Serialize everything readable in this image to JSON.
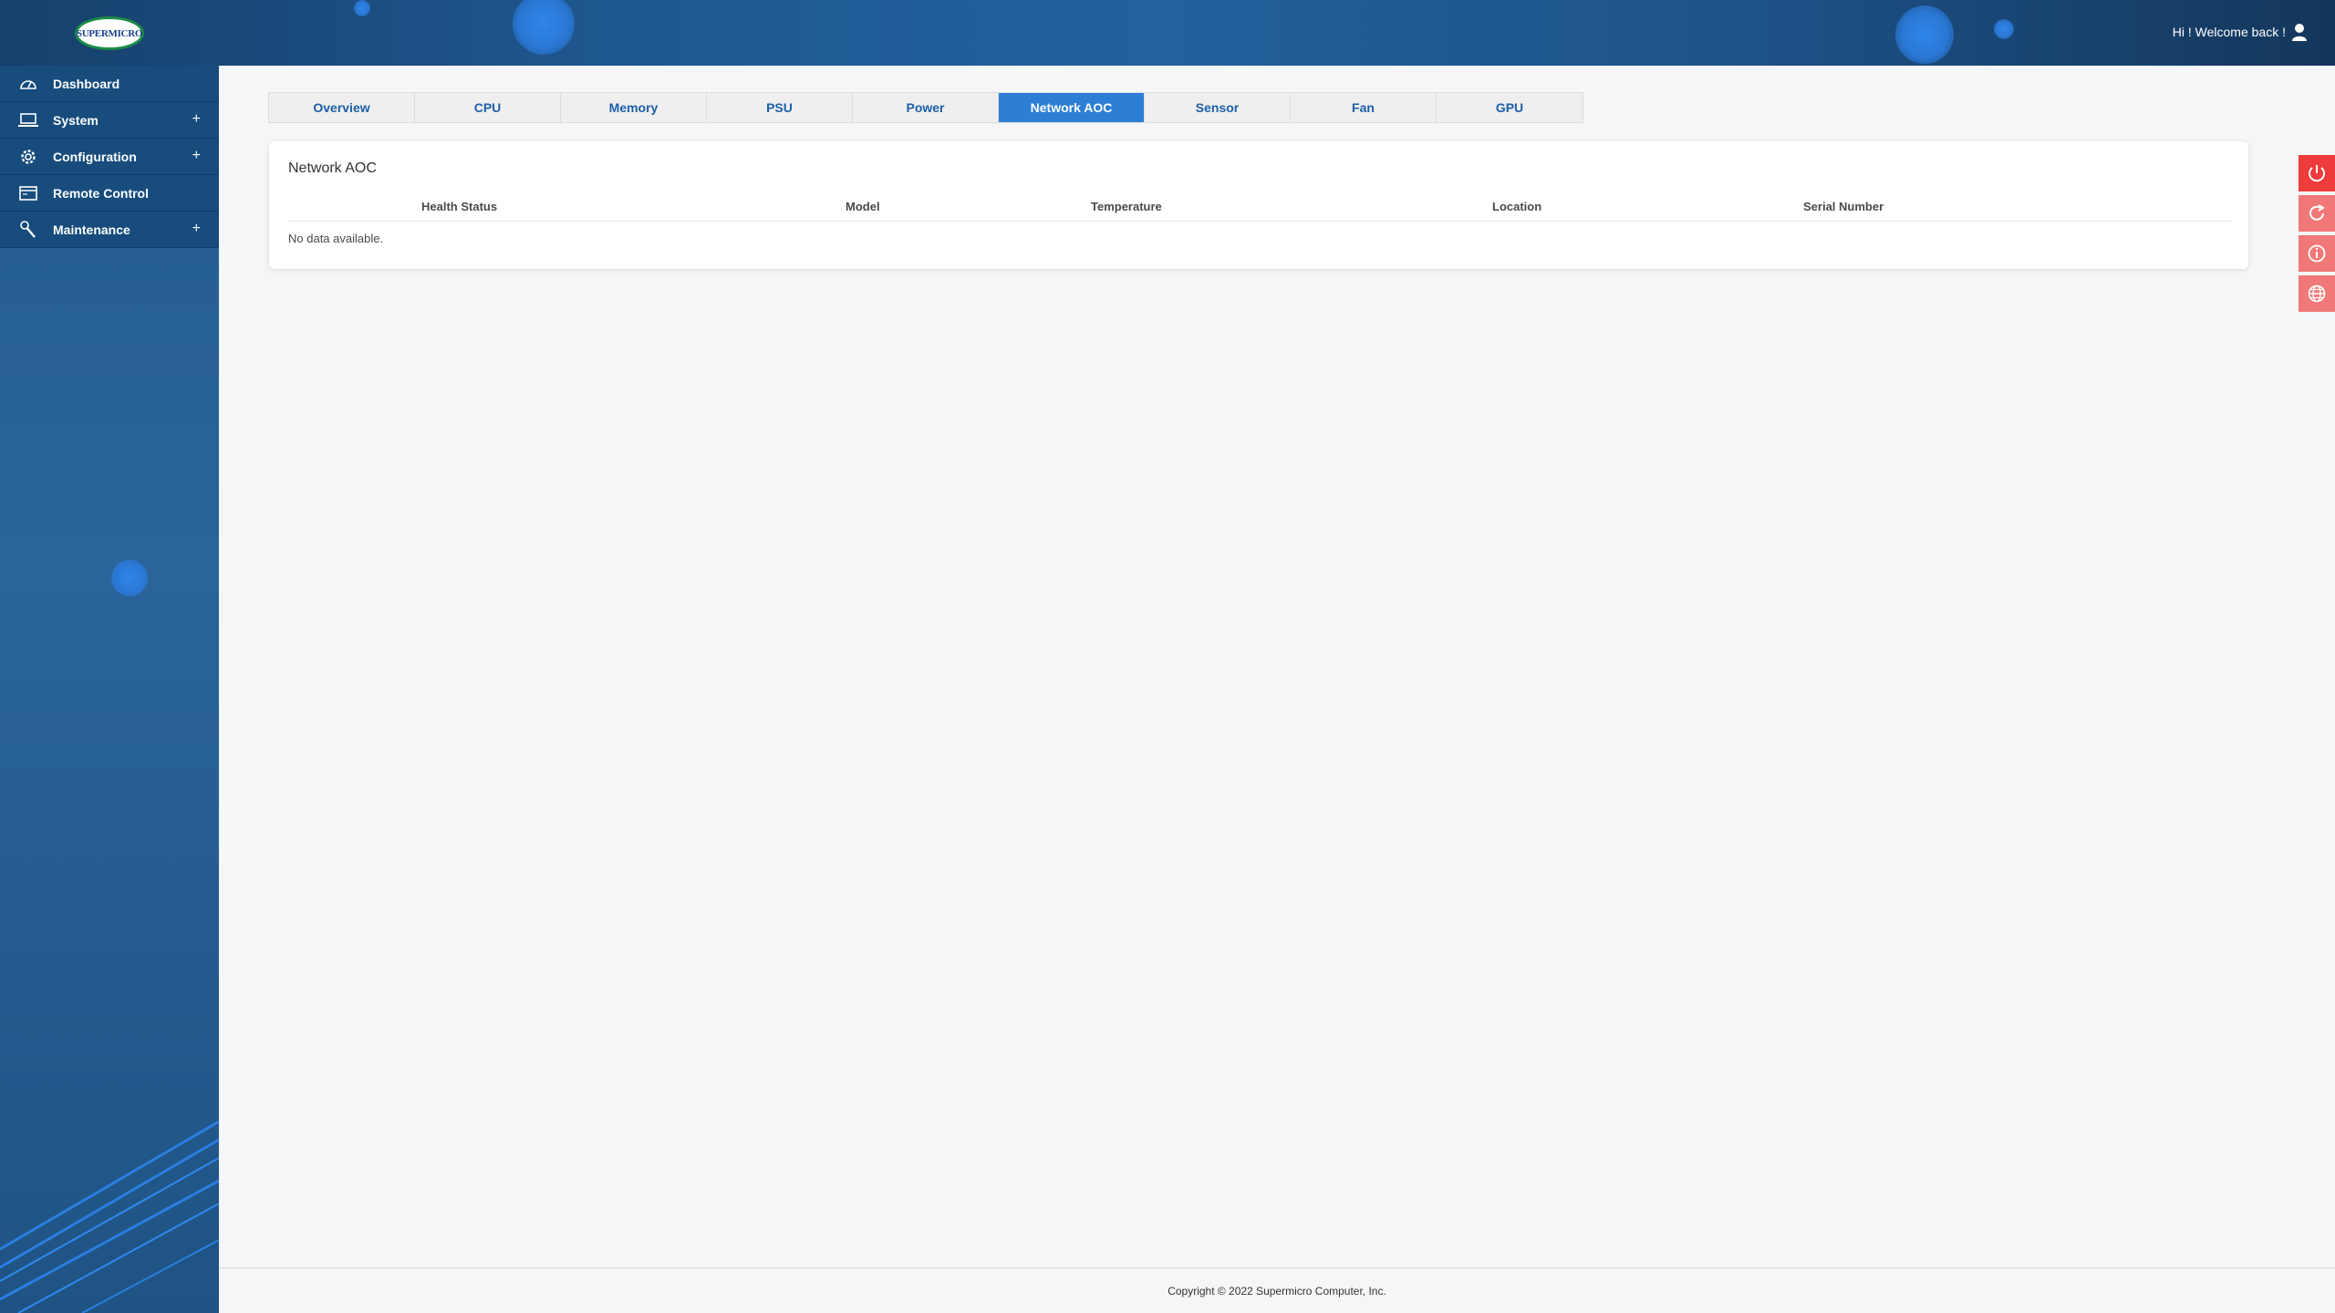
{
  "header": {
    "logo_text": "SUPERMICRO",
    "welcome": "Hi ! Welcome back !"
  },
  "sidebar": {
    "items": [
      {
        "label": "Dashboard",
        "icon": "dashboard-gauge-icon",
        "expandable": false
      },
      {
        "label": "System",
        "icon": "laptop-icon",
        "expandable": true
      },
      {
        "label": "Configuration",
        "icon": "gear-icon",
        "expandable": true
      },
      {
        "label": "Remote Control",
        "icon": "console-window-icon",
        "expandable": false
      },
      {
        "label": "Maintenance",
        "icon": "wrench-icon",
        "expandable": true
      }
    ],
    "expand_symbol": "+"
  },
  "tabs": [
    {
      "label": "Overview",
      "active": false
    },
    {
      "label": "CPU",
      "active": false
    },
    {
      "label": "Memory",
      "active": false
    },
    {
      "label": "PSU",
      "active": false
    },
    {
      "label": "Power",
      "active": false
    },
    {
      "label": "Network AOC",
      "active": true
    },
    {
      "label": "Sensor",
      "active": false
    },
    {
      "label": "Fan",
      "active": false
    },
    {
      "label": "GPU",
      "active": false
    }
  ],
  "card": {
    "title": "Network AOC",
    "columns": [
      "Health Status",
      "Model",
      "Temperature",
      "Location",
      "Serial Number"
    ],
    "empty_message": "No data available."
  },
  "actions": [
    {
      "name": "power-icon",
      "color": "#ee3b3b"
    },
    {
      "name": "refresh-icon",
      "color": "#f07878"
    },
    {
      "name": "info-icon",
      "color": "#f07878"
    },
    {
      "name": "globe-icon",
      "color": "#f07878"
    }
  ],
  "footer": {
    "copyright": "Copyright © 2022 Supermicro Computer, Inc."
  },
  "colors": {
    "header_bg": "#1f5a94",
    "sidebar_item_bg": "#174c7d",
    "tab_active": "#2d7fd6",
    "tab_text": "#1e5fa8",
    "action_red": "#ee3b3b"
  }
}
